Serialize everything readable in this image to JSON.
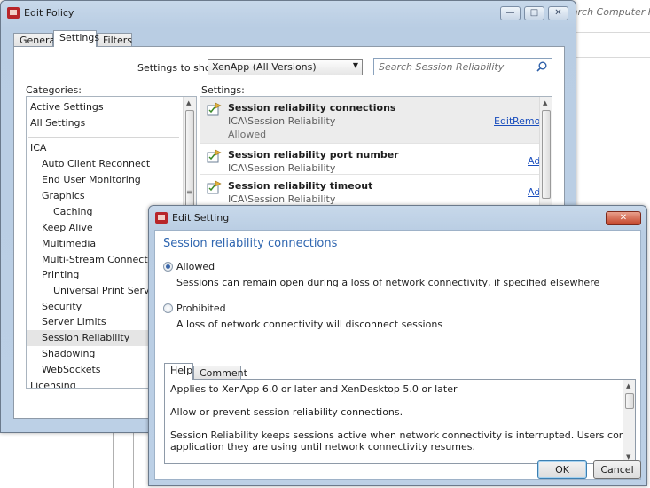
{
  "background_app": {
    "search_partial": "earch Computer Pol"
  },
  "edit_policy": {
    "title": "Edit Policy",
    "caption_buttons": {
      "minimize": "—",
      "maximize": "□",
      "close": "✕"
    },
    "tabs": [
      "General",
      "Settings",
      "Filters"
    ],
    "active_tab": "Settings",
    "settings_to_show_label": "Settings to show:",
    "settings_to_show_value": "XenApp (All Versions)",
    "search_placeholder": "Search Session Reliability",
    "categories_label": "Categories:",
    "settings_label": "Settings:",
    "categories": [
      {
        "label": "Active Settings",
        "indent": 0
      },
      {
        "label": "All Settings",
        "indent": 0
      },
      {
        "label": "ICA",
        "indent": 0
      },
      {
        "label": "Auto Client Reconnect",
        "indent": 1
      },
      {
        "label": "End User Monitoring",
        "indent": 1
      },
      {
        "label": "Graphics",
        "indent": 1
      },
      {
        "label": "Caching",
        "indent": 2
      },
      {
        "label": "Keep Alive",
        "indent": 1
      },
      {
        "label": "Multimedia",
        "indent": 1
      },
      {
        "label": "Multi-Stream Connections",
        "indent": 1
      },
      {
        "label": "Printing",
        "indent": 1
      },
      {
        "label": "Universal Print Server",
        "indent": 2
      },
      {
        "label": "Security",
        "indent": 1
      },
      {
        "label": "Server Limits",
        "indent": 1
      },
      {
        "label": "Session Reliability",
        "indent": 1,
        "selected": true
      },
      {
        "label": "Shadowing",
        "indent": 1
      },
      {
        "label": "WebSockets",
        "indent": 1
      },
      {
        "label": "Licensing",
        "indent": 0
      }
    ],
    "settings": [
      {
        "name": "Session reliability connections",
        "path": "ICA\\Session Reliability",
        "value": "Allowed",
        "actions": [
          "Edit",
          "Remove"
        ]
      },
      {
        "name": "Session reliability port number",
        "path": "ICA\\Session Reliability",
        "actions": [
          "Add"
        ]
      },
      {
        "name": "Session reliability timeout",
        "path": "ICA\\Session Reliability",
        "actions": [
          "Add"
        ]
      }
    ]
  },
  "edit_setting": {
    "title": "Edit Setting",
    "close": "✕",
    "heading": "Session reliability connections",
    "options": [
      {
        "label": "Allowed",
        "description": "Sessions can remain open during a loss of network connectivity, if specified elsewhere",
        "selected": true
      },
      {
        "label": "Prohibited",
        "description": "A loss of network connectivity will disconnect sessions",
        "selected": false
      }
    ],
    "tabs": [
      "Help",
      "Comment"
    ],
    "active_tab": "Help",
    "help_lines": [
      "Applies to XenApp 6.0 or later and XenDesktop 5.0 or later",
      "Allow or prevent session reliability connections.",
      "Session Reliability keeps sessions active when network connectivity is interrupted. Users continue to see the",
      "application they are using until network connectivity resumes."
    ],
    "ok_label": "OK",
    "cancel_label": "Cancel"
  },
  "colors": {
    "accent_heading": "#2f66b0",
    "link": "#1a4ebd",
    "title_bar": "#bcd0e6",
    "close_button": "#c4452a"
  }
}
